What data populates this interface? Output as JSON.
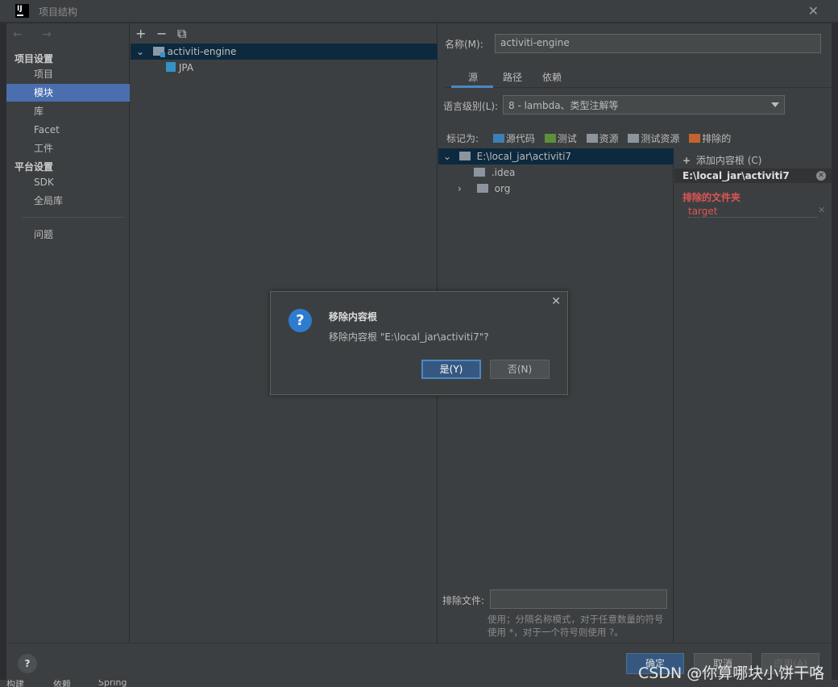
{
  "window": {
    "title": "项目结构"
  },
  "nav": {
    "arrows": "←  →",
    "group_project": "项目设置",
    "group_platform": "平台设置",
    "items": [
      {
        "label": "项目"
      },
      {
        "label": "模块"
      },
      {
        "label": "库"
      },
      {
        "label": "Facet"
      },
      {
        "label": "工件"
      },
      {
        "label": "SDK"
      },
      {
        "label": "全局库"
      },
      {
        "label": "问题"
      }
    ],
    "selected": "模块"
  },
  "modules": {
    "toolbar": {
      "add": "+",
      "remove": "−",
      "copy": "⧉"
    },
    "tree": [
      {
        "label": "activiti-engine",
        "expanded": true
      },
      {
        "label": "JPA"
      }
    ]
  },
  "detail": {
    "name_label": "名称(M):",
    "name_value": "activiti-engine",
    "tabs": [
      {
        "label": "源"
      },
      {
        "label": "路径"
      },
      {
        "label": "依赖"
      }
    ],
    "active_tab": "源",
    "language_label": "语言级别(L):",
    "language_value": "8 - lambda、类型注解等",
    "mark_label": "标记为:",
    "marks": [
      {
        "label": "源代码",
        "color": "#3d7fb5"
      },
      {
        "label": "测试",
        "color": "#5f8f3c"
      },
      {
        "label": "资源",
        "color": "#8c959e"
      },
      {
        "label": "测试资源",
        "color": "#8c959e"
      },
      {
        "label": "排除的",
        "color": "#c4632f"
      }
    ],
    "content_tree": [
      {
        "label": "E:\\local_jar\\activiti7",
        "expanded": true
      },
      {
        "label": ".idea"
      },
      {
        "label": "org",
        "collapsed": true
      }
    ],
    "add_root_label": "添加内容根 (C)",
    "root_path": "E:\\local_jar\\activiti7",
    "excluded_title": "排除的文件夹",
    "excluded_items": [
      "target"
    ],
    "exclude_files_label": "排除文件:",
    "exclude_files_value": "",
    "hint": "使用；分隔名称模式，对于任意数量的符号使用 *，对于一个符号则使用 ?。"
  },
  "footer": {
    "help": "?",
    "ok": "确定",
    "cancel": "取消",
    "apply": "应用(A)"
  },
  "bottom_tabs": [
    "构建",
    "依赖",
    "Spring"
  ],
  "watermark": "CSDN @你算哪块小饼干咯",
  "dialog": {
    "title": "移除内容根",
    "message": "移除内容根 \"E:\\local_jar\\activiti7\"?",
    "yes": "是(Y)",
    "no": "否(N)"
  }
}
